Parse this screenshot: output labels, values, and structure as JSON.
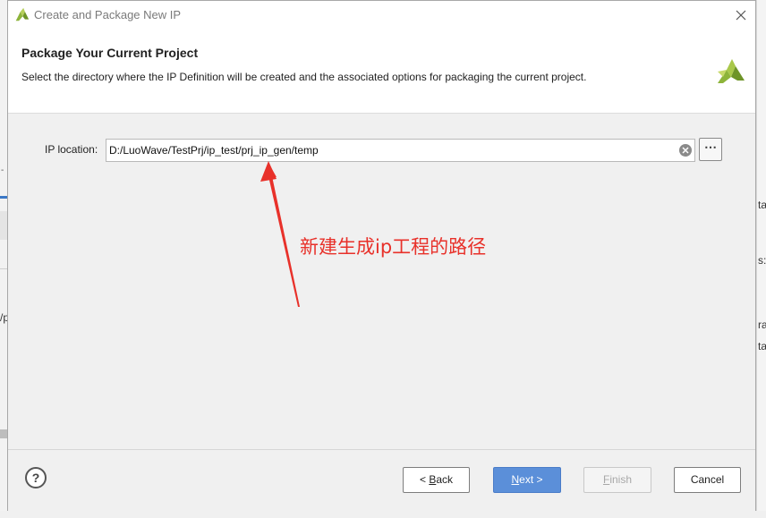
{
  "window": {
    "title": "Create and Package New IP",
    "close_icon": "close-icon"
  },
  "header": {
    "title": "Package Your Current Project",
    "description": "Select the directory where the IP Definition will be created and the associated options for packaging the current project."
  },
  "form": {
    "ip_location_label": "IP location:",
    "ip_location_value": "D:/LuoWave/TestPrj/ip_test/prj_ip_gen/temp",
    "browse_label": "⋯"
  },
  "annotation": {
    "text": "新建生成ip工程的路径",
    "color": "#e8312a"
  },
  "footer": {
    "help_label": "?",
    "back_prefix": "< ",
    "back_mnemonic": "B",
    "back_rest": "ack",
    "next_mnemonic": "N",
    "next_rest": "ext >",
    "finish_mnemonic": "F",
    "finish_rest": "inish",
    "cancel_label": "Cancel"
  },
  "background": {
    "left_fragment": "/p",
    "left_dash": "-",
    "right_fragments": [
      "ta",
      "s:",
      "ra",
      "ta"
    ]
  },
  "colors": {
    "accent": "#5b8fd9",
    "logo_green": "#8db43a",
    "logo_dark": "#5a7a1e"
  }
}
